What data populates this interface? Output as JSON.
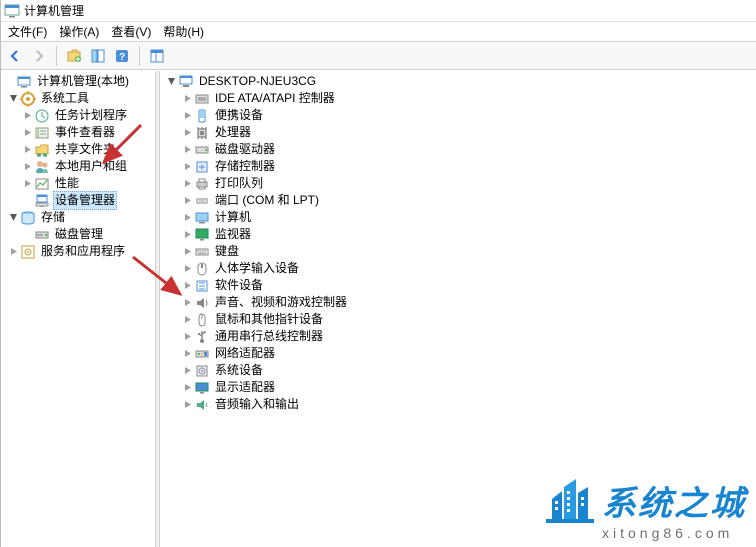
{
  "titlebar": {
    "title": "计算机管理"
  },
  "menubar": {
    "items": [
      {
        "label": "文件(F)"
      },
      {
        "label": "操作(A)"
      },
      {
        "label": "查看(V)"
      },
      {
        "label": "帮助(H)"
      }
    ]
  },
  "toolbar": {
    "back": "back-icon",
    "forward": "forward-icon",
    "refresh": "refresh-icon",
    "show_hide": "show-hide-icon",
    "help": "help-icon",
    "layout": "layout-icon"
  },
  "left_tree": {
    "root": {
      "label": "计算机管理(本地)",
      "icon": "computer-mgmt"
    },
    "system_tools": {
      "label": "系统工具",
      "children": [
        {
          "label": "任务计划程序",
          "icon": "scheduler"
        },
        {
          "label": "事件查看器",
          "icon": "event-viewer"
        },
        {
          "label": "共享文件夹",
          "icon": "shared-folders"
        },
        {
          "label": "本地用户和组",
          "icon": "users-groups"
        },
        {
          "label": "性能",
          "icon": "performance"
        },
        {
          "label": "设备管理器",
          "icon": "device-manager",
          "selected": true
        }
      ]
    },
    "storage": {
      "label": "存储",
      "children": [
        {
          "label": "磁盘管理",
          "icon": "disk-mgmt"
        }
      ]
    },
    "services": {
      "label": "服务和应用程序",
      "icon": "services"
    }
  },
  "right_tree": {
    "root": {
      "label": "DESKTOP-NJEU3CG",
      "icon": "computer"
    },
    "children": [
      {
        "label": "IDE ATA/ATAPI 控制器",
        "icon": "ide"
      },
      {
        "label": "便携设备",
        "icon": "portable"
      },
      {
        "label": "处理器",
        "icon": "cpu"
      },
      {
        "label": "磁盘驱动器",
        "icon": "disk"
      },
      {
        "label": "存储控制器",
        "icon": "storage-ctrl"
      },
      {
        "label": "打印队列",
        "icon": "printer"
      },
      {
        "label": "端口 (COM 和 LPT)",
        "icon": "port"
      },
      {
        "label": "计算机",
        "icon": "pc"
      },
      {
        "label": "监视器",
        "icon": "monitor"
      },
      {
        "label": "键盘",
        "icon": "keyboard"
      },
      {
        "label": "人体学输入设备",
        "icon": "hid"
      },
      {
        "label": "软件设备",
        "icon": "software"
      },
      {
        "label": "声音、视频和游戏控制器",
        "icon": "sound"
      },
      {
        "label": "鼠标和其他指针设备",
        "icon": "mouse"
      },
      {
        "label": "通用串行总线控制器",
        "icon": "usb"
      },
      {
        "label": "网络适配器",
        "icon": "network"
      },
      {
        "label": "系统设备",
        "icon": "system-dev"
      },
      {
        "label": "显示适配器",
        "icon": "display"
      },
      {
        "label": "音频输入和输出",
        "icon": "audio-io"
      }
    ]
  },
  "watermark": {
    "brand_cn": "系统之城",
    "url": "xitong86.com"
  },
  "annotations": {
    "arrow_top_color": "#c83232",
    "arrow_bottom_color": "#c83232"
  }
}
